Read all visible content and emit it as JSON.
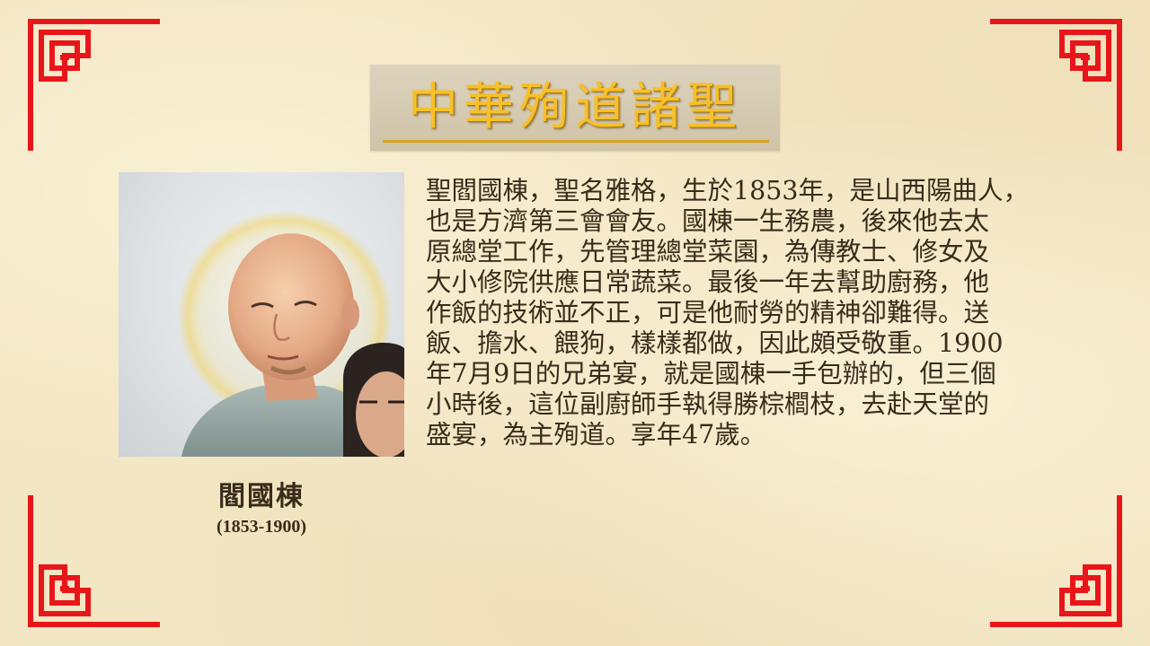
{
  "title": "中華殉道諸聖",
  "portrait": {
    "name": "閻國棟",
    "years": "(1853-1900)"
  },
  "body_text": "聖閻國棟，聖名雅格，生於1853年，是山西陽曲人，\n也是方濟第三會會友。國棟一生務農，後來他去太\n原總堂工作，先管理總堂菜園，為傳教士、修女及\n大小修院供應日常蔬菜。最後一年去幫助廚務，他\n作飯的技術並不正，可是他耐勞的精神卻難得。送\n飯、擔水、餵狗，樣樣都做，因此頗受敬重。1900\n年7月9日的兄弟宴，就是國棟一手包辦的，但三個\n小時後，這位副廚師手執得勝棕櫚枝，去赴天堂的\n盛宴，為主殉道。享年47歲。",
  "colors": {
    "frame_red": "#e8161b",
    "title_gold": "#f6c02a",
    "background": "#f3e6c3",
    "text": "#3a2c1a"
  },
  "icons": [
    "corner-fret-ornament",
    "portrait-painting"
  ]
}
